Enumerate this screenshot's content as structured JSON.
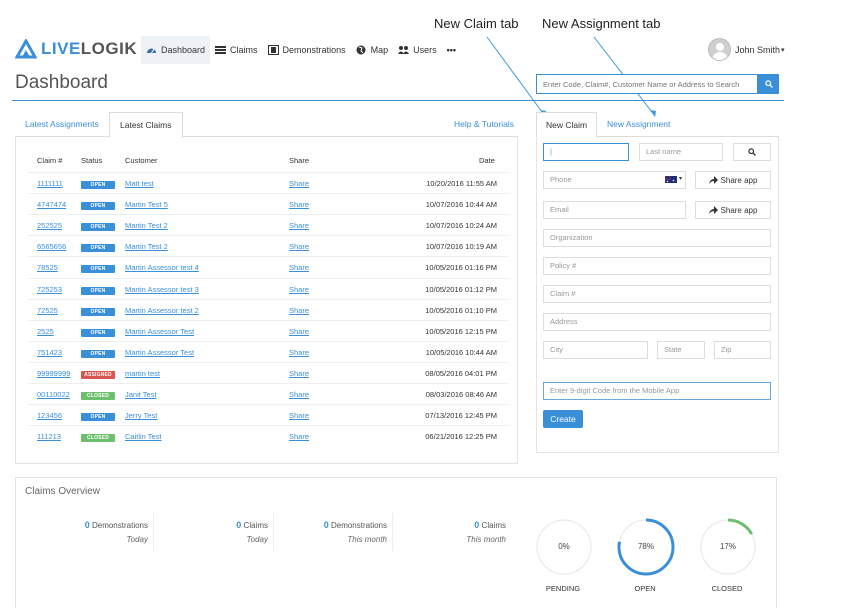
{
  "annotations": {
    "new_claim_tab": "New Claim tab",
    "new_assignment_tab": "New Assignment tab"
  },
  "brand": {
    "logo_live": "LIVE",
    "logo_logik": "LOGIK",
    "accent": "#3a8fd9"
  },
  "nav": {
    "items": [
      {
        "label": "Dashboard",
        "icon": "dashboard-icon"
      },
      {
        "label": "Claims",
        "icon": "claims-list-icon"
      },
      {
        "label": "Demonstrations",
        "icon": "film-icon"
      },
      {
        "label": "Map",
        "icon": "globe-icon"
      },
      {
        "label": "Users",
        "icon": "users-icon"
      }
    ],
    "more": "•••"
  },
  "user": {
    "name": "John Smith",
    "caret": "▾"
  },
  "page": {
    "title": "Dashboard"
  },
  "search": {
    "placeholder": "Enter Code, Claim#, Customer Name or Address to Search"
  },
  "left_tabs": {
    "latest_assignments": "Latest Assignments",
    "latest_claims": "Latest Claims",
    "help": "Help & Tutorials"
  },
  "claims_table": {
    "headers": {
      "claim": "Claim #",
      "status": "Status",
      "customer": "Customer",
      "share": "Share",
      "date": "Date"
    },
    "rows": [
      {
        "claim": "1111111",
        "status": "OPEN",
        "customer": "Matt test",
        "share": "Share",
        "date": "10/20/2016 11:55 AM"
      },
      {
        "claim": "4747474",
        "status": "OPEN",
        "customer": "Martin Test 5",
        "share": "Share",
        "date": "10/07/2016 10:44 AM"
      },
      {
        "claim": "252525",
        "status": "OPEN",
        "customer": "Martin Test 2",
        "share": "Share",
        "date": "10/07/2016 10:24 AM"
      },
      {
        "claim": "6565656",
        "status": "OPEN",
        "customer": "Martin Test 2",
        "share": "Share",
        "date": "10/07/2016 10:19 AM"
      },
      {
        "claim": "78525",
        "status": "OPEN",
        "customer": "Martin Assessor test 4",
        "share": "Share",
        "date": "10/05/2016 01:16 PM"
      },
      {
        "claim": "725253",
        "status": "OPEN",
        "customer": "Martin Assessor test 3",
        "share": "Share",
        "date": "10/05/2016 01:12 PM"
      },
      {
        "claim": "72525",
        "status": "OPEN",
        "customer": "Martin Assessor test 2",
        "share": "Share",
        "date": "10/05/2016 01:10 PM"
      },
      {
        "claim": "2525",
        "status": "OPEN",
        "customer": "Martin Assessor Test",
        "share": "Share",
        "date": "10/05/2016 12:15 PM"
      },
      {
        "claim": "751423",
        "status": "OPEN",
        "customer": "Martin Assessor Test",
        "share": "Share",
        "date": "10/05/2016 10:44 AM"
      },
      {
        "claim": "99999999",
        "status": "ASSIGNED",
        "customer": "martin test",
        "share": "Share",
        "date": "08/05/2016 04:01 PM"
      },
      {
        "claim": "00110022",
        "status": "CLOSED",
        "customer": "Janit Test",
        "share": "Share",
        "date": "08/03/2016 08:46 AM"
      },
      {
        "claim": "123456",
        "status": "OPEN",
        "customer": "Jerry Test",
        "share": "Share",
        "date": "07/13/2016 12:45 PM"
      },
      {
        "claim": "111213",
        "status": "CLOSED",
        "customer": "Caitlin Test",
        "share": "Share",
        "date": "06/21/2016 12:25 PM"
      }
    ]
  },
  "right_tabs": {
    "new_claim": "New Claim",
    "new_assignment": "New Assignment"
  },
  "form": {
    "first_name_value": "|",
    "last_name_placeholder": "Last name",
    "phone_placeholder": "Phone",
    "flag_caret": "▾",
    "share_app": "Share app",
    "email_placeholder": "Email",
    "organization_placeholder": "Organization",
    "policy_placeholder": "Policy #",
    "claim_placeholder": "Claim #",
    "address_placeholder": "Address",
    "city_placeholder": "City",
    "state_placeholder": "State",
    "zip_placeholder": "Zip",
    "code_placeholder": "Enter 9-digit Code from the Mobile App",
    "create": "Create"
  },
  "overview": {
    "title": "Claims Overview",
    "stats": [
      {
        "num": "0",
        "label": "Demonstrations",
        "sub": "Today"
      },
      {
        "num": "0",
        "label": "Claims",
        "sub": "Today"
      },
      {
        "num": "0",
        "label": "Demonstrations",
        "sub": "This month"
      },
      {
        "num": "0",
        "label": "Claims",
        "sub": "This month"
      }
    ],
    "gauges": [
      {
        "label": "PENDING",
        "pct_text": "0%",
        "fraction": 0,
        "color": "#3a8fd9"
      },
      {
        "label": "OPEN",
        "pct_text": "78%",
        "fraction": 0.78,
        "color": "#3a8fd9"
      },
      {
        "label": "CLOSED",
        "pct_text": "17%",
        "fraction": 0.17,
        "color": "#6cbf6c"
      }
    ]
  }
}
